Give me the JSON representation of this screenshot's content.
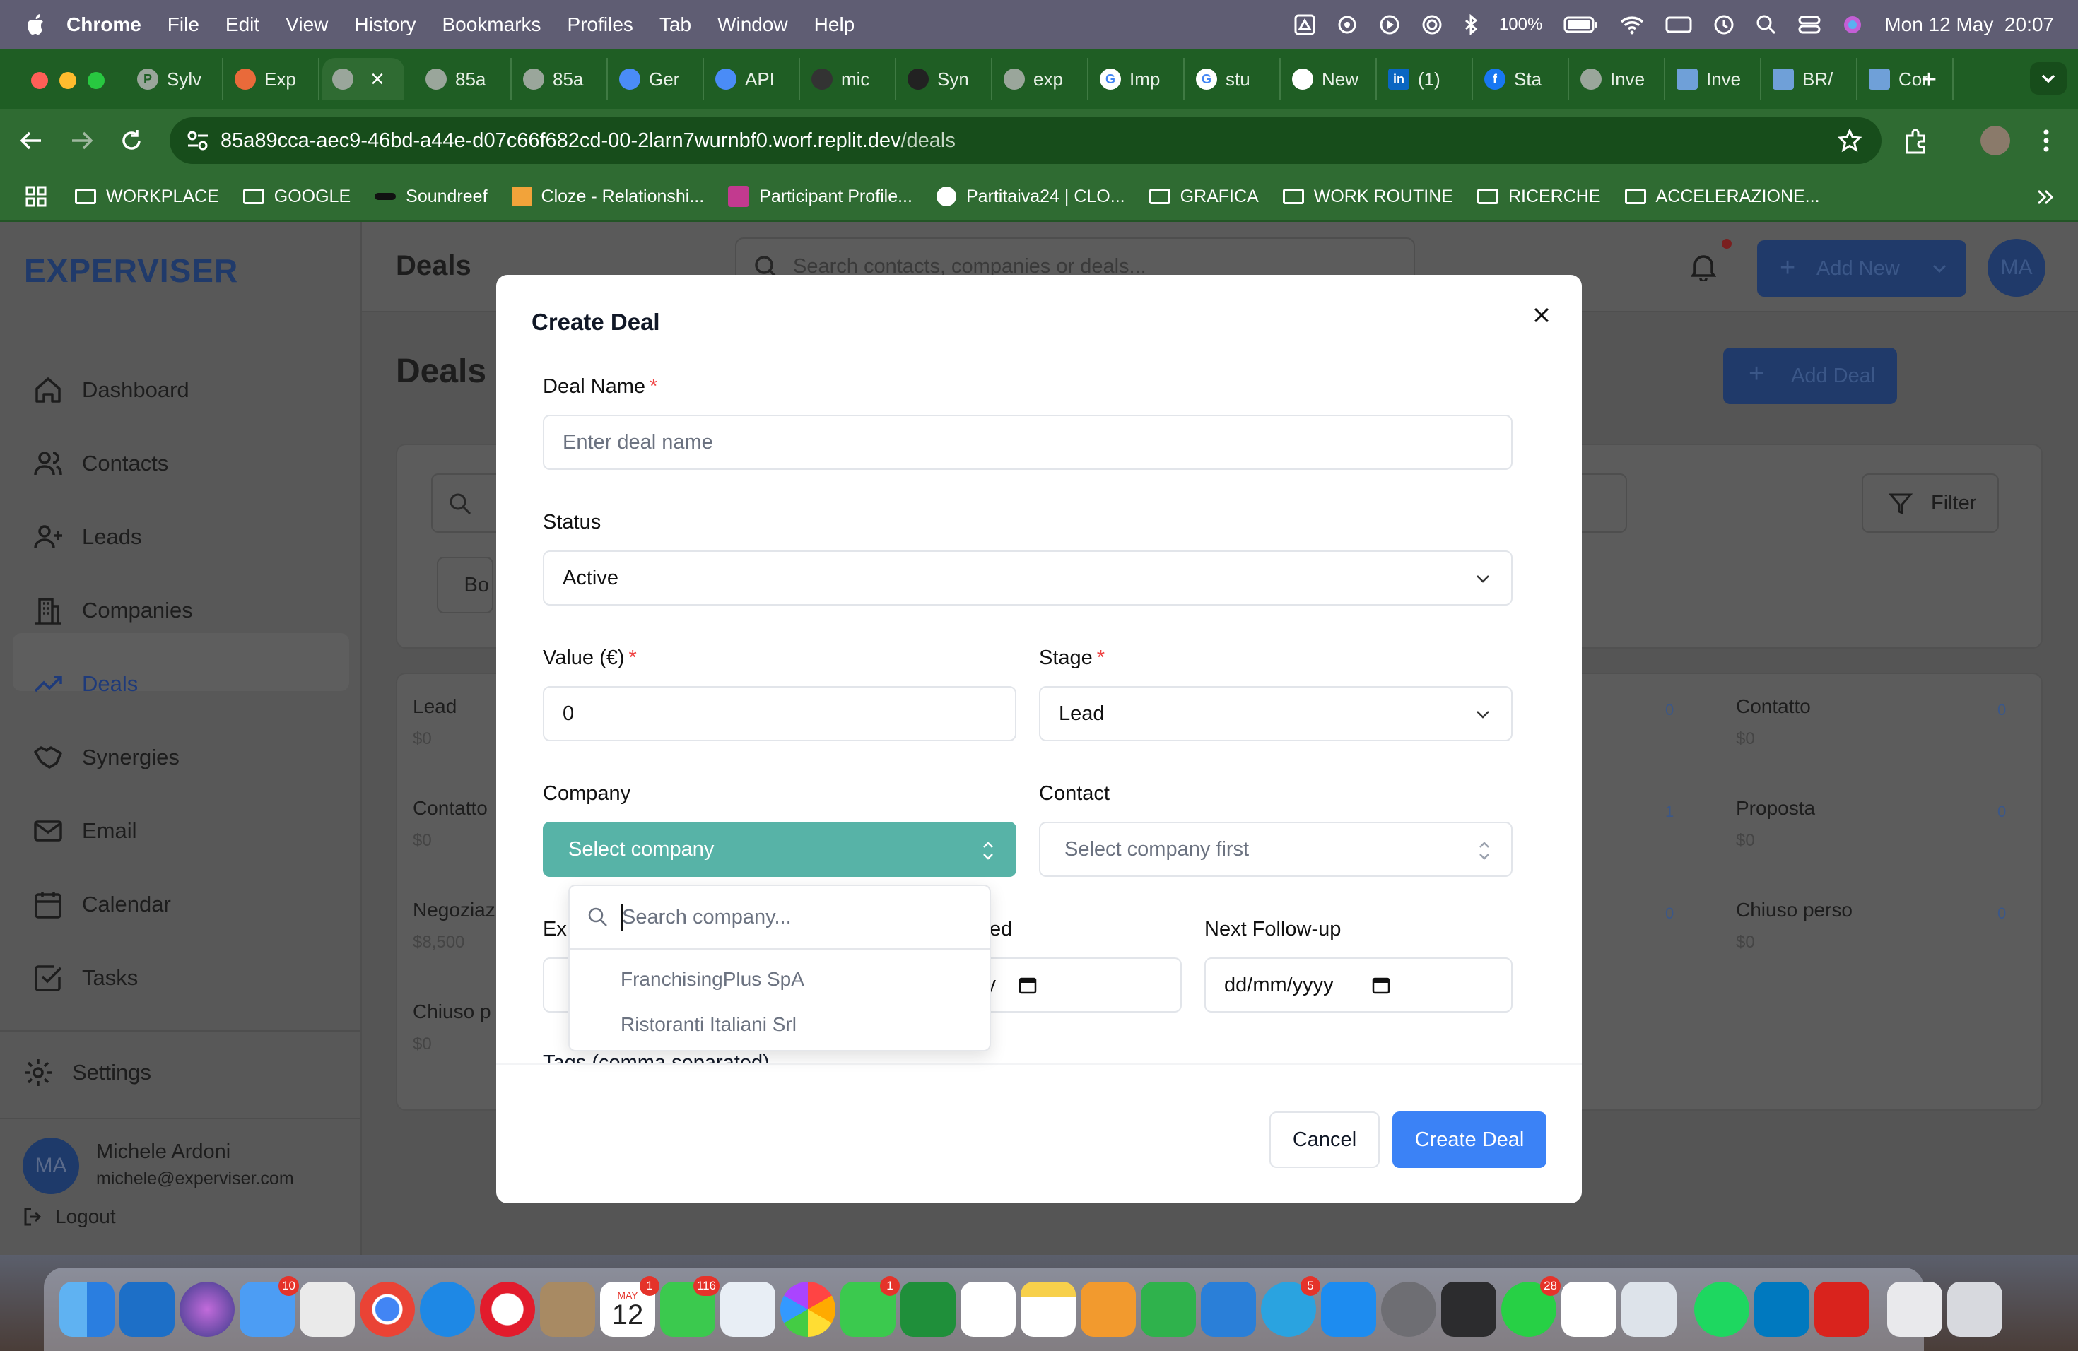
{
  "menubar": {
    "app": "Chrome",
    "items": [
      "File",
      "Edit",
      "View",
      "History",
      "Bookmarks",
      "Profiles",
      "Tab",
      "Window",
      "Help"
    ],
    "battery": "100%",
    "datetime": "Mon 12 May  20:07"
  },
  "chrome": {
    "tabs": [
      "Sylv",
      "Exp",
      "",
      "85a",
      "85a",
      "Ger",
      "API",
      "mic",
      "Syn",
      "exp",
      "Imp",
      "stu",
      "New",
      "(1)",
      "Sta",
      "Inve",
      "Inve",
      "BR/",
      "Cor"
    ],
    "url_host": "85a89cca-aec9-46bd-a44e-d07c66f682cd-00-2larn7wurnbf0.worf.replit.dev",
    "url_path": "/deals",
    "bookmarks": [
      "WORKPLACE",
      "GOOGLE",
      "Soundreef",
      "Cloze - Relationshi...",
      "Participant Profile...",
      "Partitaiva24 | CLO...",
      "GRAFICA",
      "WORK ROUTINE",
      "RICERCHE",
      "ACCELERAZIONE..."
    ]
  },
  "app": {
    "brand": "EXPERVISER",
    "nav": [
      "Dashboard",
      "Contacts",
      "Leads",
      "Companies",
      "Deals",
      "Synergies",
      "Email",
      "Calendar",
      "Tasks"
    ],
    "settings": "Settings",
    "user": {
      "initials": "MA",
      "name": "Michele Ardoni",
      "email": "michele@experviser.com"
    },
    "logout": "Logout",
    "header_title": "Deals",
    "search_placeholder": "Search contacts, companies or deals...",
    "add_new": "Add New",
    "page_title": "Deals",
    "add_deal": "Add Deal",
    "filter": "Filter",
    "left_columns": [
      {
        "name": "Lead",
        "amount": "$0"
      },
      {
        "name": "Contatto",
        "amount": "$0"
      },
      {
        "name": "Negoziaz",
        "amount": "$8,500"
      },
      {
        "name": "Chiuso p",
        "amount": "$0"
      }
    ],
    "right_columns": [
      {
        "name": "Contatto",
        "amount": "$0",
        "count": "0"
      },
      {
        "name": "Proposta",
        "amount": "$0",
        "count": "0"
      },
      {
        "name": "Chiuso perso",
        "amount": "$0",
        "count": "0"
      }
    ],
    "mid_counts": [
      "0",
      "1",
      "0"
    ]
  },
  "modal": {
    "title": "Create Deal",
    "deal_name_label": "Deal Name",
    "deal_name_placeholder": "Enter deal name",
    "status_label": "Status",
    "status_value": "Active",
    "value_label": "Value (€)",
    "value_value": "0",
    "stage_label": "Stage",
    "stage_value": "Lead",
    "company_label": "Company",
    "company_value": "Select company",
    "contact_label": "Contact",
    "contact_value": "Select company first",
    "expected_label_partial": "Exp",
    "mid_label_partial": "ed",
    "mid_date_partial": "yy",
    "next_followup_label": "Next Follow-up",
    "date_placeholder": "dd/mm/yyyy",
    "tags_label_partial": "Tags (comma separated)",
    "cancel": "Cancel",
    "create": "Create Deal",
    "required_mark": "*"
  },
  "company_dropdown": {
    "search_placeholder": "Search company...",
    "options": [
      "FranchisingPlus SpA",
      "Ristoranti Italiani Srl"
    ]
  },
  "dock": {
    "badges": {
      "mail": "10",
      "calendar": "1",
      "messages": "116",
      "facetime": "1",
      "telegram": "5",
      "whatsapp": "28"
    },
    "calendar_month": "MAY",
    "calendar_day": "12"
  },
  "colors": {
    "accent": "#3b82f6",
    "company_select": "#57b3a7",
    "required": "#ef4444",
    "chrome_green": "#2f6b32"
  }
}
